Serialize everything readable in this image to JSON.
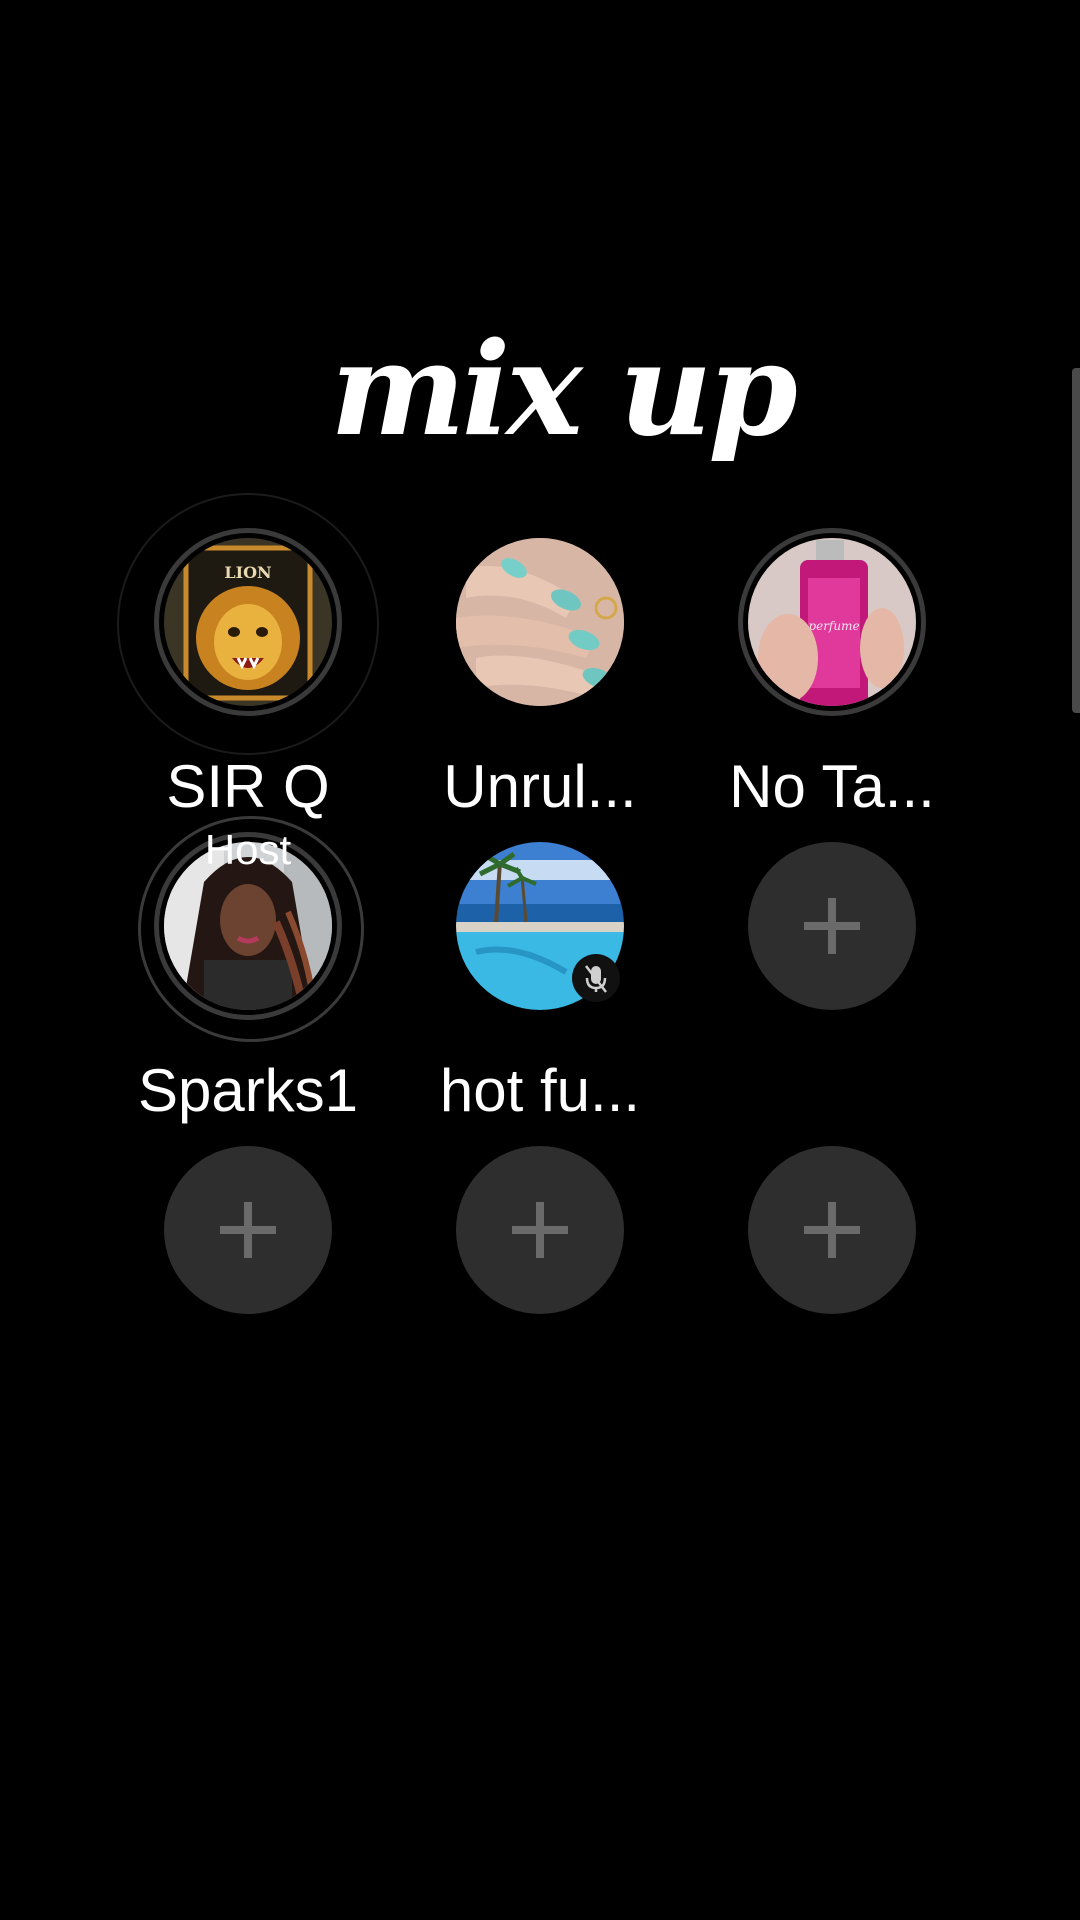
{
  "room": {
    "title": "mix up"
  },
  "seats": [
    {
      "name": "SIR Q",
      "avatar": "lion-logo-avatar",
      "host": false,
      "muted": false
    },
    {
      "name": "Unrul...",
      "avatar": "manicured-nails-avatar",
      "host": false,
      "muted": false
    },
    {
      "name": "No Ta...",
      "avatar": "pink-perfume-bottle-avatar",
      "host": false,
      "muted": false
    },
    {
      "name": "Sparks1",
      "avatar": "woman-selfie-avatar",
      "host": true,
      "host_label": "Host",
      "muted": false
    },
    {
      "name": "hot fu...",
      "avatar": "pool-ocean-avatar",
      "host": false,
      "muted": true
    },
    {
      "empty": true,
      "icon": "plus-icon"
    },
    {
      "empty": true,
      "icon": "plus-icon"
    },
    {
      "empty": true,
      "icon": "plus-icon"
    },
    {
      "empty": true,
      "icon": "plus-icon"
    }
  ],
  "colors": {
    "background": "#000000",
    "empty_seat": "#2e2e2e",
    "plus": "#6a6a6a",
    "text": "#ffffff"
  }
}
